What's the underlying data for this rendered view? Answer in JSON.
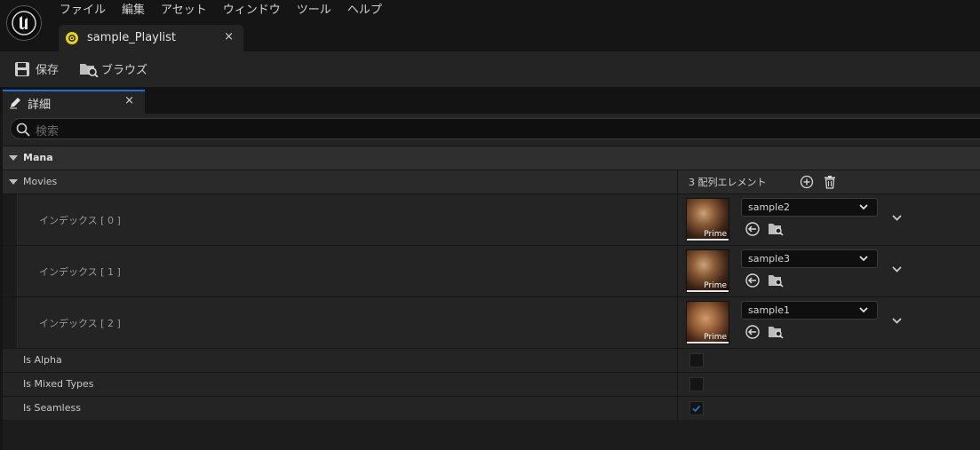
{
  "menu": [
    "ファイル",
    "編集",
    "アセット",
    "ウィンドウ",
    "ツール",
    "ヘルプ"
  ],
  "document_tab": {
    "label": "sample_Playlist",
    "close": "×"
  },
  "toolbar": {
    "save_label": "保存",
    "browse_label": "ブラウズ"
  },
  "details_tab": {
    "label": "詳細",
    "close": "×"
  },
  "search": {
    "placeholder": "検索"
  },
  "category": "Mana",
  "movies": {
    "label": "Movies",
    "count_label": "3 配列エレメント",
    "items": [
      {
        "index_label": "インデックス [ 0 ]",
        "asset": "sample2",
        "badge": "Prime"
      },
      {
        "index_label": "インデックス [ 1 ]",
        "asset": "sample3",
        "badge": "Prime"
      },
      {
        "index_label": "インデックス [ 2 ]",
        "asset": "sample1",
        "badge": "Prime"
      }
    ]
  },
  "bools": [
    {
      "label": "Is Alpha",
      "checked": false
    },
    {
      "label": "Is Mixed Types",
      "checked": false
    },
    {
      "label": "Is Seamless",
      "checked": true
    }
  ],
  "colors": {
    "accent": "#1f6fd6",
    "asset_icon": "#e3d11d",
    "check": "#2f6fc0"
  }
}
